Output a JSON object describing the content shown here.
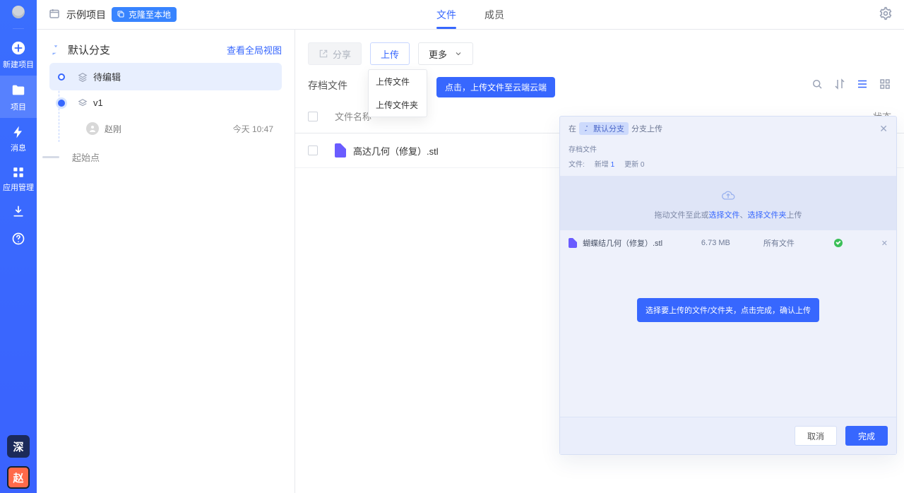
{
  "rail": {
    "items": [
      {
        "label": "新建项目"
      },
      {
        "label": "项目"
      },
      {
        "label": "消息"
      },
      {
        "label": "应用管理"
      }
    ],
    "deep": "深",
    "shortname": "赵"
  },
  "topbar": {
    "project_name": "示例项目",
    "badge": "克隆至本地",
    "tabs": [
      {
        "label": "文件",
        "active": true
      },
      {
        "label": "成员",
        "active": false
      }
    ]
  },
  "branch": {
    "title": "默认分支",
    "global_link": "查看全局视图",
    "nodes": {
      "edit": "待编辑",
      "v": "v1",
      "author": "赵刚",
      "time": "今天 10:47",
      "origin": "起始点"
    }
  },
  "main": {
    "share": "分享",
    "upload": "上传",
    "more": "更多",
    "upload_dropdown": [
      "上传文件",
      "上传文件夹"
    ],
    "tooltip": "点击，上传文件至云端云端",
    "section_title": "存档文件",
    "cols": {
      "name": "文件名称",
      "status": "状态"
    },
    "rows": [
      {
        "name": "高达几何（修复）.stl"
      }
    ]
  },
  "panel": {
    "in": "在",
    "chip": "默认分支",
    "suffix": "分支上传",
    "subheader": "存档文件",
    "stats": {
      "label": "文件:",
      "new_label": "新增",
      "new_count": "1",
      "upd_label": "更新",
      "upd_count": "0"
    },
    "drop_prefix": "拖动文件至此或",
    "drop_link_file": "选择文件",
    "drop_sep": "、",
    "drop_link_folder": "选择文件夹",
    "drop_suffix": "上传",
    "file": {
      "name": "蝴蝶结几何（修复）.stl",
      "size": "6.73 MB",
      "type": "所有文件"
    },
    "hint": "选择要上传的文件/文件夹，点击完成，确认上传",
    "cancel": "取消",
    "done": "完成"
  }
}
